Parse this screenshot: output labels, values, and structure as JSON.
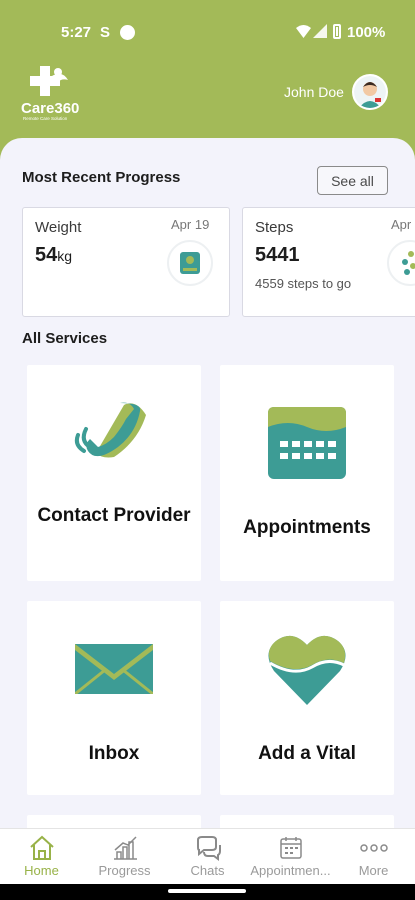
{
  "status_bar": {
    "time": "5:27",
    "s_icon": "S",
    "battery_pct": "100%"
  },
  "header": {
    "logo_text": "Care360",
    "logo_sub": "Remote Care Solution",
    "user_name": "John Doe"
  },
  "progress": {
    "title": "Most Recent Progress",
    "see_all_label": "See all",
    "cards": [
      {
        "label": "Weight",
        "date": "Apr 19",
        "value": "54",
        "unit": "kg",
        "icon": "weight-scale-icon"
      },
      {
        "label": "Steps",
        "date": "Apr",
        "value": "5441",
        "note": "4559 steps to go",
        "icon": "steps-icon"
      }
    ]
  },
  "services": {
    "title": "All Services",
    "tiles": [
      {
        "label": "Contact Provider",
        "icon": "phone-icon"
      },
      {
        "label": "Appointments",
        "icon": "calendar-icon"
      },
      {
        "label": "Inbox",
        "icon": "envelope-icon"
      },
      {
        "label": "Add a Vital",
        "icon": "heart-icon"
      }
    ]
  },
  "bottom_nav": {
    "items": [
      {
        "label": "Home",
        "icon": "home-icon",
        "active": true
      },
      {
        "label": "Progress",
        "icon": "progress-chart-icon"
      },
      {
        "label": "Chats",
        "icon": "chat-bubbles-icon"
      },
      {
        "label": "Appointmen...",
        "icon": "calendar-icon"
      },
      {
        "label": "More",
        "icon": "more-dots-icon"
      }
    ]
  },
  "colors": {
    "brand_green": "#a3ba58",
    "teal": "#3d9c95",
    "nav_active": "#98b248"
  }
}
